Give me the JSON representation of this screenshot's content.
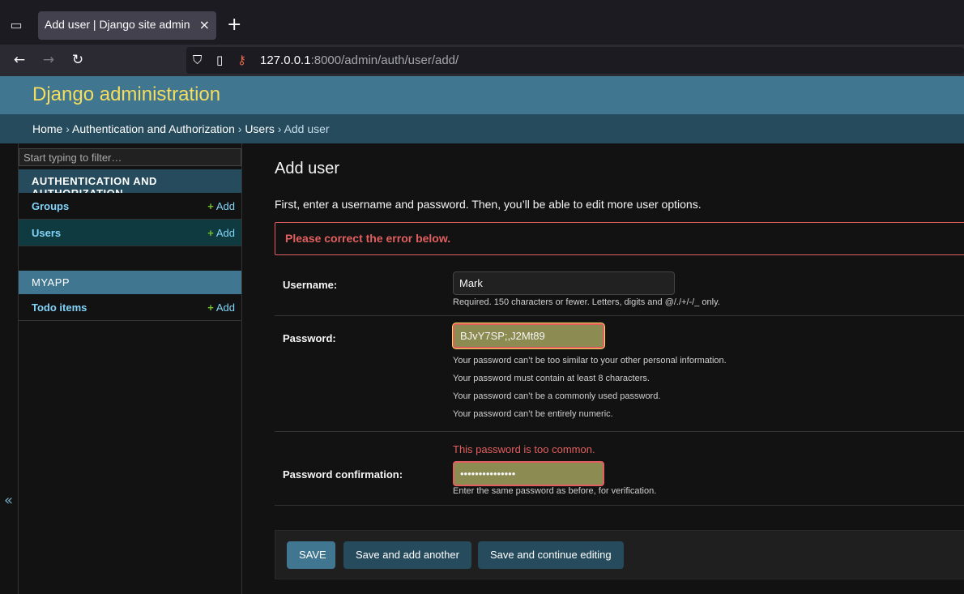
{
  "browser": {
    "tab_title": "Add user | Django site admin",
    "tab_close": "×",
    "new_tab": "+",
    "url_host": "127.0.0.1",
    "url_rest": ":8000/admin/auth/user/add/"
  },
  "header": {
    "brand": "Django administration"
  },
  "breadcrumbs": {
    "home": "Home",
    "app": "Authentication and Authorization",
    "model": "Users",
    "current": "Add user",
    "separator": "›"
  },
  "sidebar": {
    "filter_placeholder": "Start typing to filter…",
    "modules": [
      {
        "caption": "AUTHENTICATION AND AUTHORIZATION",
        "items": [
          {
            "name": "Groups",
            "add": "Add",
            "active": false
          },
          {
            "name": "Users",
            "add": "Add",
            "active": true
          }
        ]
      },
      {
        "caption": "MYAPP",
        "items": [
          {
            "name": "Todo items",
            "add": "Add",
            "active": false
          }
        ]
      }
    ],
    "collapse_glyph": "«"
  },
  "main": {
    "title": "Add user",
    "intro": "First, enter a username and password. Then, you’ll be able to edit more user options.",
    "error_note": "Please correct the error below.",
    "username": {
      "label": "Username:",
      "value": "Mark",
      "help": "Required. 150 characters or fewer. Letters, digits and @/./+/-/_ only."
    },
    "password": {
      "label": "Password:",
      "value": "BJvY7SP;,J2Mt89",
      "help": [
        "Your password can’t be too similar to your other personal information.",
        "Your password must contain at least 8 characters.",
        "Your password can’t be a commonly used password.",
        "Your password can’t be entirely numeric."
      ]
    },
    "password_confirm": {
      "label": "Password confirmation:",
      "value": "•••••••••••••••",
      "error": "This password is too common.",
      "help": "Enter the same password as before, for verification."
    },
    "buttons": {
      "save": "SAVE",
      "save_add_another": "Save and add another",
      "save_continue": "Save and continue editing"
    }
  },
  "colors": {
    "header": "#417690",
    "brand": "#f5dd5d",
    "breadcrumbs": "#264b5d",
    "error": "#e35f5f",
    "link": "#81d4fa",
    "add_plus": "#70bf2b"
  }
}
